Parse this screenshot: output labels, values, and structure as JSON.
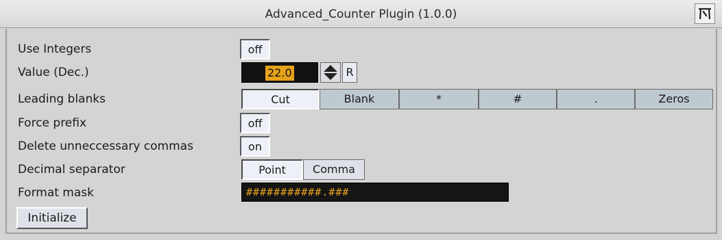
{
  "window": {
    "title": "Advanced_Counter Plugin (1.0.0)",
    "logo_icon": "plugin-logo-icon"
  },
  "rows": {
    "use_integers": {
      "label": "Use Integers",
      "value": "off"
    },
    "value_dec": {
      "label": "Value (Dec.)",
      "value": "22.0",
      "reset_label": "R"
    },
    "leading_blanks": {
      "label": "Leading blanks",
      "options": [
        "Cut",
        "Blank",
        "*",
        "#",
        ".",
        "Zeros"
      ],
      "selected": "Cut"
    },
    "force_prefix": {
      "label": "Force prefix",
      "value": "off"
    },
    "delete_commas": {
      "label": "Delete unneccessary commas",
      "value": "on"
    },
    "decimal_separator": {
      "label": "Decimal separator",
      "options": [
        "Point",
        "Comma"
      ],
      "selected": "Point"
    },
    "format_mask": {
      "label": "Format mask",
      "value": "###########.###"
    }
  },
  "actions": {
    "initialize_label": "Initialize"
  },
  "colors": {
    "accent": "#e8a21a",
    "field_bg": "#151515",
    "panel_bg": "#d4d4d4"
  }
}
